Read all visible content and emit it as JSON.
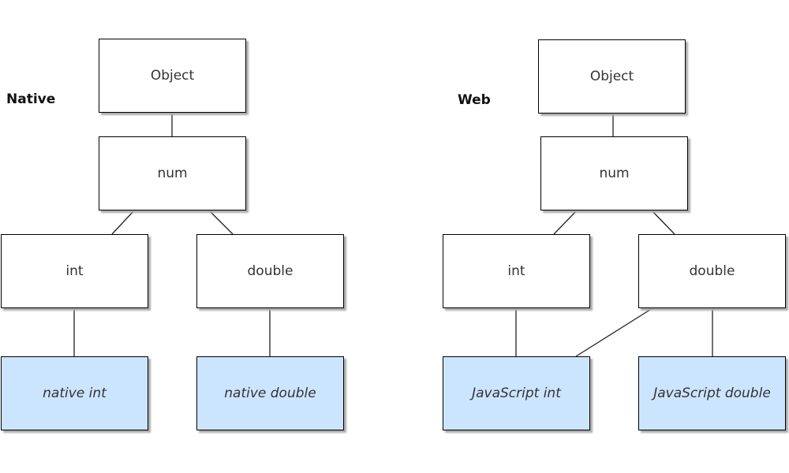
{
  "native": {
    "title": "Native",
    "object": "Object",
    "num": "num",
    "int": "int",
    "double": "double",
    "int_impl": "native int",
    "double_impl": "native double"
  },
  "web": {
    "title": "Web",
    "object": "Object",
    "num": "num",
    "int": "int",
    "double": "double",
    "int_impl": "JavaScript int",
    "double_impl": "JavaScript double"
  },
  "colors": {
    "leaf_fill": "#cce5ff",
    "box_fill": "#ffffff",
    "stroke": "#000000"
  }
}
